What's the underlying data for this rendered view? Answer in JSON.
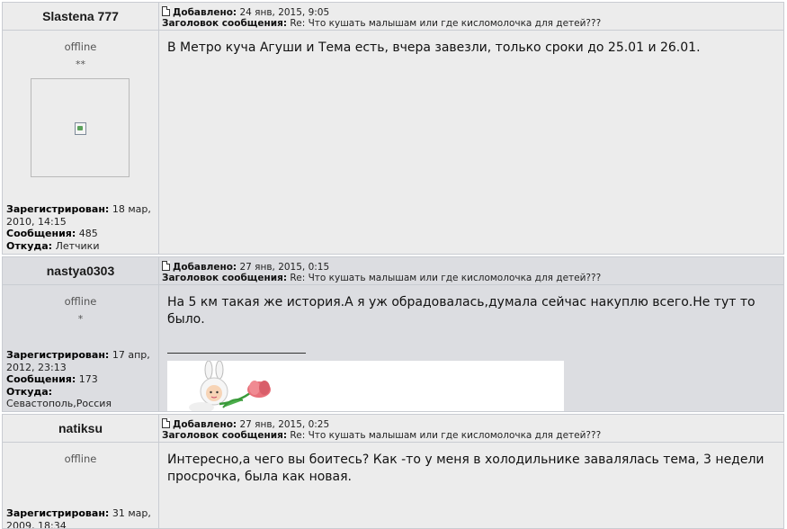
{
  "posts": [
    {
      "username": "Slastena 777",
      "added_label": "Добавлено:",
      "added_value": "24 янв, 2015, 9:05",
      "subject_label": "Заголовок сообщения:",
      "subject_value": "Re: Что кушать малышам или где кисломолочка для детей???",
      "status": "offline",
      "rank_stars": "**",
      "registered_label": "Зарегистрирован:",
      "registered_value": "18 мар, 2010, 14:15",
      "messages_label": "Сообщения:",
      "messages_value": "485",
      "from_label": "Откуда:",
      "from_value": "Летчики",
      "message": "В Метро куча Агуши и Тема есть, вчера завезли, только сроки до 25.01 и 26.01."
    },
    {
      "username": "nastya0303",
      "added_label": "Добавлено:",
      "added_value": "27 янв, 2015, 0:15",
      "subject_label": "Заголовок сообщения:",
      "subject_value": "Re: Что кушать малышам или где кисломолочка для детей???",
      "status": "offline",
      "rank_stars": "*",
      "registered_label": "Зарегистрирован:",
      "registered_value": "17 апр, 2012, 23:13",
      "messages_label": "Сообщения:",
      "messages_value": "173",
      "from_label": "Откуда:",
      "from_value": "Севастополь,Россия",
      "message": "На 5 км такая же история.А я уж обрадовалась,думала сейчас накуплю всего.Не тут то было."
    },
    {
      "username": "natiksu",
      "added_label": "Добавлено:",
      "added_value": "27 янв, 2015, 0:25",
      "subject_label": "Заголовок сообщения:",
      "subject_value": "Re: Что кушать малышам или где кисломолочка для детей???",
      "status": "offline",
      "registered_label": "Зарегистрирован:",
      "registered_value": "31 мар, 2009, 18:34",
      "message": "Интересно,а чего вы боитесь? Как -то у меня в холодильнике завалялась тема, 3 недели просрочка, была как новая."
    }
  ]
}
